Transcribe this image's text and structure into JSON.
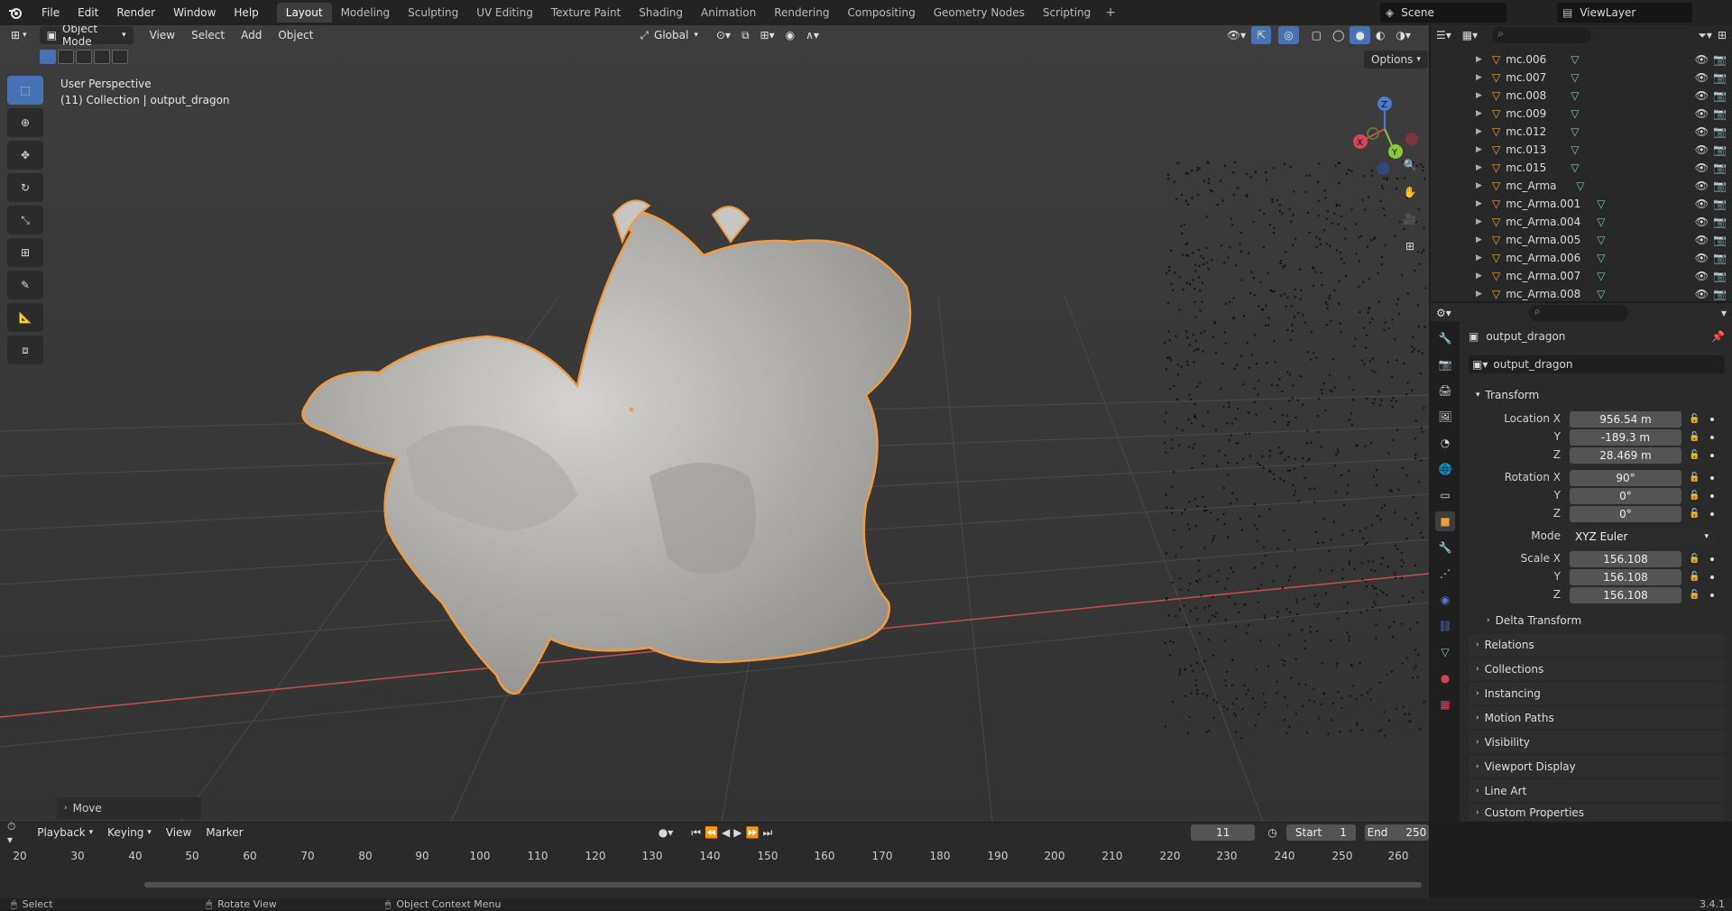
{
  "top_menu": {
    "items": [
      "File",
      "Edit",
      "Render",
      "Window",
      "Help"
    ]
  },
  "workspace_tabs": [
    {
      "label": "Layout",
      "active": true
    },
    {
      "label": "Modeling",
      "active": false
    },
    {
      "label": "Sculpting",
      "active": false
    },
    {
      "label": "UV Editing",
      "active": false
    },
    {
      "label": "Texture Paint",
      "active": false
    },
    {
      "label": "Shading",
      "active": false
    },
    {
      "label": "Animation",
      "active": false
    },
    {
      "label": "Rendering",
      "active": false
    },
    {
      "label": "Compositing",
      "active": false
    },
    {
      "label": "Geometry Nodes",
      "active": false
    },
    {
      "label": "Scripting",
      "active": false
    }
  ],
  "scene": {
    "name": "Scene"
  },
  "view_layer": {
    "name": "ViewLayer"
  },
  "viewport": {
    "mode": "Object Mode",
    "menus": [
      "View",
      "Select",
      "Add",
      "Object"
    ],
    "transform_orientation": "Global",
    "info_line1": "User Perspective",
    "info_line2": "(11) Collection | output_dragon",
    "options_label": "Options",
    "last_operator": "Move",
    "gizmo_axes": {
      "x": "X",
      "y": "Y",
      "z": "Z"
    },
    "object_outline_color": "#f19c3c",
    "axis_x_color": "#c44f4f",
    "dragon_color": "#b9b7b4"
  },
  "outliner": {
    "items": [
      {
        "name": "mc.006"
      },
      {
        "name": "mc.007"
      },
      {
        "name": "mc.008"
      },
      {
        "name": "mc.009"
      },
      {
        "name": "mc.012"
      },
      {
        "name": "mc.013"
      },
      {
        "name": "mc.015"
      },
      {
        "name": "mc_Arma"
      },
      {
        "name": "mc_Arma.001"
      },
      {
        "name": "mc_Arma.004"
      },
      {
        "name": "mc_Arma.005"
      },
      {
        "name": "mc_Arma.006"
      },
      {
        "name": "mc_Arma.007"
      },
      {
        "name": "mc_Arma.008"
      }
    ]
  },
  "properties": {
    "object_name": "output_dragon",
    "datablock_name": "output_dragon",
    "transform_label": "Transform",
    "location_label": "Location X",
    "location": {
      "x": "956.54 m",
      "y": "-189.3 m",
      "z": "28.469 m"
    },
    "rotation_label": "Rotation X",
    "rotation": {
      "x": "90°",
      "y": "0°",
      "z": "0°"
    },
    "mode_label": "Mode",
    "mode_value": "XYZ Euler",
    "scale_label": "Scale X",
    "scale": {
      "x": "156.108",
      "y": "156.108",
      "z": "156.108"
    },
    "axis_y": "Y",
    "axis_z": "Z",
    "sections": [
      "Delta Transform",
      "Relations",
      "Collections",
      "Instancing",
      "Motion Paths",
      "Visibility",
      "Viewport Display",
      "Line Art",
      "Custom Properties"
    ]
  },
  "timeline": {
    "menus": [
      "Playback",
      "Keying",
      "View",
      "Marker"
    ],
    "current_frame": "11",
    "start_label": "Start",
    "start": "1",
    "end_label": "End",
    "end": "250",
    "ruler": [
      "20",
      "30",
      "40",
      "50",
      "60",
      "70",
      "80",
      "90",
      "100",
      "110",
      "120",
      "130",
      "140",
      "150",
      "160",
      "170",
      "180",
      "190",
      "200",
      "210",
      "220",
      "230",
      "240",
      "250",
      "260"
    ]
  },
  "statusbar": {
    "select": "Select",
    "rotate": "Rotate View",
    "context": "Object Context Menu",
    "version": "3.4.1"
  }
}
